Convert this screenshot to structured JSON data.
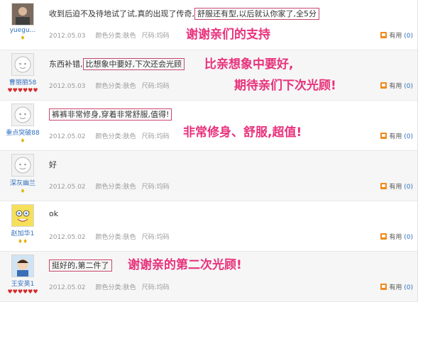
{
  "reviews": [
    {
      "username": "yuegu...",
      "level": "♦",
      "content_plain": "收到后迫不及待地试了试,真的出现了传奇,",
      "content_highlight": "舒服还有型,以后就认你家了,全5分",
      "date": "2012.05.03",
      "color_label": "颜色分类:肤色",
      "size_label": "尺码:均码",
      "useful_label": "有用",
      "useful_count": "(0)"
    },
    {
      "username": "曹丽丽58",
      "level": "♥♥♥♥♥♥",
      "content_plain": "东西补错,",
      "content_highlight": "比想象中要好,下次还会光顾",
      "date": "2012.05.03",
      "color_label": "颜色分类:肤色",
      "size_label": "尺码:均码",
      "useful_label": "有用",
      "useful_count": "(0)"
    },
    {
      "username": "重点突破88",
      "level": "♦",
      "content_plain": "",
      "content_highlight": "裤裤非常修身,穿着非常舒服,值得!",
      "date": "2012.05.02",
      "color_label": "颜色分类:肤色",
      "size_label": "尺码:均码",
      "useful_label": "有用",
      "useful_count": "(0)"
    },
    {
      "username": "深灰幽兰",
      "level": "♦",
      "content_plain": "好",
      "content_highlight": "",
      "date": "2012.05.02",
      "color_label": "颜色分类:肤色",
      "size_label": "尺码:均码",
      "useful_label": "有用",
      "useful_count": "(0)"
    },
    {
      "username": "赵加华1",
      "level": "♦♦",
      "content_plain": "ok",
      "content_highlight": "",
      "date": "2012.05.02",
      "color_label": "颜色分类:肤色",
      "size_label": "尺码:均码",
      "useful_label": "有用",
      "useful_count": "(0)"
    },
    {
      "username": "王安英1",
      "level": "♥♥♥♥♥♥",
      "content_plain": "",
      "content_highlight": "挺好的,第二件了",
      "date": "2012.05.02",
      "color_label": "颜色分类:肤色",
      "size_label": "尺码:均码",
      "useful_label": "有用",
      "useful_count": "(0)"
    }
  ],
  "annotations": {
    "note1": "谢谢亲们的支持",
    "note2a": "比亲想象中要好,",
    "note2b": "期待亲们下次光顾!",
    "note3": "非常修身、舒服,超值!",
    "note4": "谢谢亲的第二次光顾!"
  },
  "colors": {
    "annotation": "#e8327c",
    "highlight_border": "#c8476b",
    "link": "#2f6fbf"
  }
}
